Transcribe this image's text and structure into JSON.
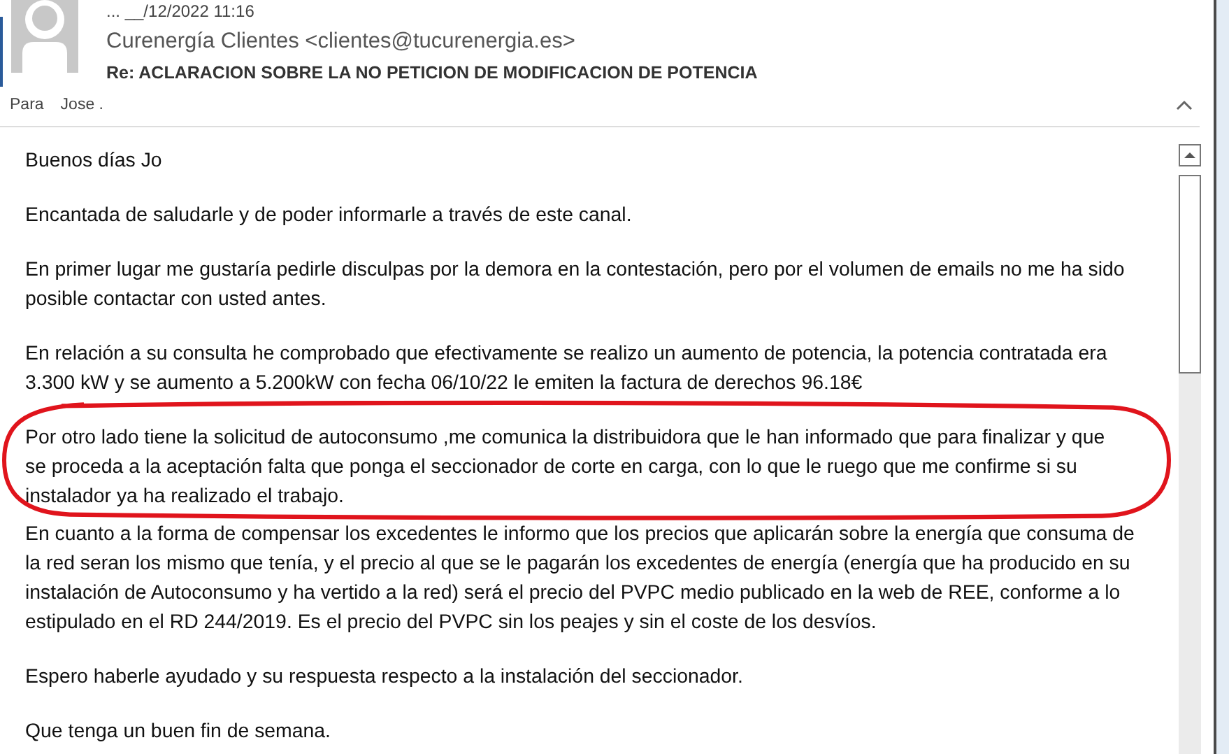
{
  "message": {
    "date": "... __/12/2022 11:16",
    "sender": "Curenergía Clientes <clientes@tucurenergia.es>",
    "subject": "Re: ACLARACION SOBRE LA NO PETICION DE MODIFICACION DE POTENCIA",
    "to_label": "Para",
    "to": "Jose ."
  },
  "body": [
    {
      "lines": [
        "Buenos días Jo"
      ]
    },
    {
      "lines": [
        "Encantada de saludarle y de poder informarle a través de este canal."
      ]
    },
    {
      "lines": [
        "En primer lugar me gustaría pedirle disculpas por la demora en la contestación, pero por el volumen de emails no me ha sido",
        "posible contactar con usted antes."
      ]
    },
    {
      "lines": [
        "En relación a su consulta he comprobado que efectivamente se realizo un aumento de potencia, la potencia contratada era",
        "3.300 kW y se aumento a 5.200kW con fecha 06/10/22 le emiten la factura de derechos 96.18€"
      ]
    },
    {
      "lines": [
        "Por otro lado tiene la solicitud de autoconsumo ,me comunica la distribuidora que le han informado que para finalizar y que",
        "se proceda a la aceptación falta que ponga el seccionador de corte en carga, con lo que le ruego que me confirme si su",
        "instalador ya ha realizado el trabajo."
      ],
      "circled": true
    },
    {
      "lines": [
        "En cuanto a la forma de compensar los excedentes le informo que los precios que aplicarán sobre la energía que consuma de",
        "la red seran los mismo que tenía, y el precio al que se le pagarán los excedentes de energía (energía que ha producido en su",
        "instalación de Autoconsumo y ha vertido a la red) será el precio del PVPC medio publicado en la web de REE, conforme a lo",
        "estipulado en el RD 244/2019. Es el precio del PVPC sin los peajes y sin el coste de los desvíos."
      ]
    },
    {
      "lines": [
        "Espero haberle ayudado y su respuesta respecto a la instalación del seccionador."
      ]
    },
    {
      "lines": [
        "Que tenga un buen fin de semana."
      ]
    }
  ]
}
